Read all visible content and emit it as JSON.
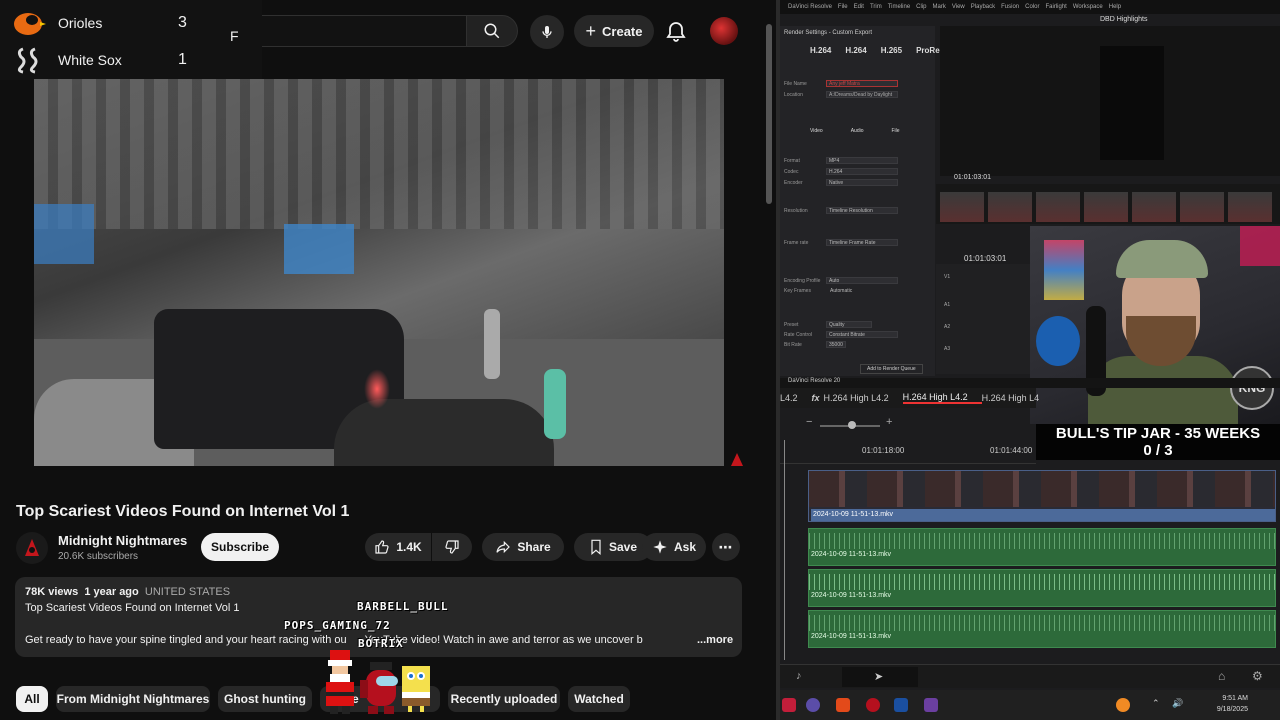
{
  "scoreboard": {
    "teams": [
      {
        "name": "Orioles",
        "runs": "3"
      },
      {
        "name": "White Sox",
        "runs": "1"
      }
    ],
    "status": "F"
  },
  "youtube": {
    "topbar": {
      "create_label": "Create"
    },
    "video": {
      "title": "Top Scariest Videos Found on Internet Vol 1"
    },
    "channel": {
      "name": "Midnight Nightmares",
      "subscribers": "20.6K subscribers",
      "subscribe_label": "Subscribe"
    },
    "actions": {
      "likes": "1.4K",
      "share_label": "Share",
      "save_label": "Save",
      "ask_label": "Ask"
    },
    "description": {
      "views": "78K views",
      "age": "1 year ago",
      "country": "UNITED STATES",
      "line1": "Top Scariest Videos Found on Internet Vol 1",
      "line2": "Get ready to have your spine tingled and your heart racing with ou",
      "line2_rest": "YouTube video!  Watch in awe and terror as we uncover b",
      "more_label": "...more"
    },
    "chips": [
      "All",
      "From Midnight Nightmares",
      "Ghost hunting",
      "",
      "Recently uploaded",
      "Watched"
    ],
    "chips_partial": "te"
  },
  "overlay_names": {
    "user1": "BARBELL_BULL",
    "user2": "POPS_GAMING_72",
    "user3": "BOTRIX"
  },
  "davinci": {
    "menu": [
      "DaVinci Resolve",
      "File",
      "Edit",
      "Trim",
      "Timeline",
      "Clip",
      "Mark",
      "View",
      "Playback",
      "Fusion",
      "Color",
      "Fairlight",
      "Workspace",
      "Help"
    ],
    "project_title": "DBD Highlights",
    "render_header": "Render Settings - Custom Export",
    "formats": [
      "H.264",
      "H.264",
      "H.265",
      "ProRe"
    ],
    "filename_value": "Any jeff Matra",
    "location_value": "A:/Dreams/Dead by Daylight",
    "render_rows": [
      {
        "label": "File Name"
      },
      {
        "label": "Location"
      },
      {
        "label": "Format",
        "value": "MP4"
      },
      {
        "label": "Codec",
        "value": "H.264"
      },
      {
        "label": "Encoder",
        "value": "Native"
      },
      {
        "label": "Resolution",
        "value": "Timeline Resolution"
      },
      {
        "label": "Frame rate",
        "value": "Timeline Frame Rate"
      },
      {
        "label": "Encoding Profile",
        "value": "Auto"
      },
      {
        "label": "Key Frames",
        "value": "Automatic"
      },
      {
        "label": "Preset",
        "value": "Quality"
      },
      {
        "label": "Rate Control",
        "value": "Constant Bitrate"
      },
      {
        "label": "Bit Rate",
        "value": "35000"
      }
    ],
    "render_tabs": [
      "Video",
      "Audio",
      "File"
    ],
    "add_queue_label": "Add to Render Queue",
    "viewer_timecode": "01:01:03:01",
    "timeline_timecode": "01:01:03:01",
    "panel_title": "DaVinci Resolve 20",
    "codec_strip": [
      "L4.2",
      "H.264 High L4.2",
      "H.264 High L4.2",
      "H.264 High L4"
    ],
    "ruler": [
      "01:01:18:00",
      "01:01:44:00"
    ],
    "clip_name": "2024-10-09 11-51-13.mkv",
    "tip_jar": {
      "title": "BULL'S TIP JAR - 35 WEEKS",
      "count": "0 / 3"
    },
    "webcam_logo": "KNG",
    "clock": {
      "time": "9:51 AM",
      "date": "9/18/2025"
    }
  }
}
